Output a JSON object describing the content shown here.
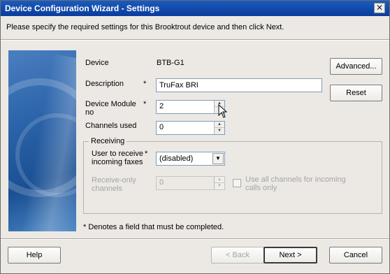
{
  "window": {
    "title": "Device Configuration Wizard - Settings",
    "close_glyph": "✕"
  },
  "instructions": "Please specify the required settings for this Brooktrout device and then click Next.",
  "form": {
    "device_label": "Device",
    "device_value": "BTB-G1",
    "description_label": "Description",
    "description_value": "TruFax BRI",
    "module_label_line1": "Device Module",
    "module_label_line2": "no",
    "module_value": "2",
    "channels_label": "Channels used",
    "channels_value": "0",
    "required_marker": "*"
  },
  "receiving": {
    "title": "Receiving",
    "user_label_line1": "User to receive",
    "user_label_line2": "incoming faxes",
    "user_value": "(disabled)",
    "receive_only_label_line1": "Receive-only",
    "receive_only_label_line2": "channels",
    "receive_only_value": "0",
    "use_all_line1": "Use all channels for incoming",
    "use_all_line2": "calls only"
  },
  "side_buttons": {
    "advanced": "Advanced...",
    "reset": "Reset"
  },
  "footnote": "* Denotes a field that must be completed.",
  "footer": {
    "help": "Help",
    "back": "< Back",
    "next": "Next >",
    "cancel": "Cancel"
  },
  "icons": {
    "spin_up": "▲",
    "spin_down": "▼",
    "dropdown_arrow": "▼"
  }
}
